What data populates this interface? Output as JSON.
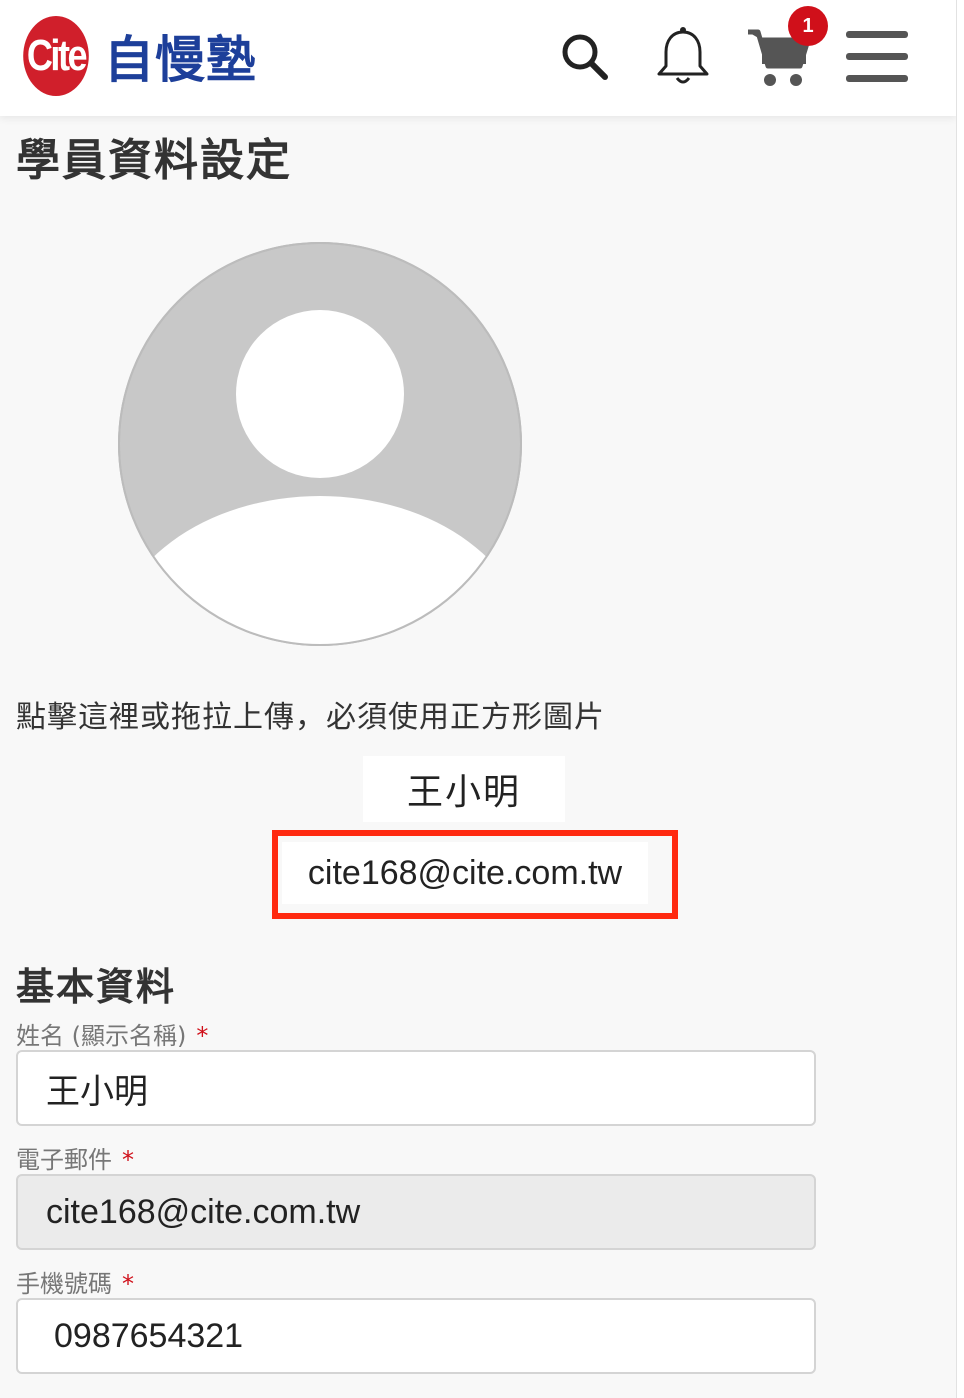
{
  "header": {
    "logo_mark": "Cite",
    "logo_text": "自慢塾",
    "cart_count": "1",
    "icons": [
      "search-icon",
      "bell-icon",
      "cart-icon",
      "menu-icon"
    ]
  },
  "page": {
    "title": "學員資料設定"
  },
  "profile": {
    "upload_hint": "點擊這裡或拖拉上傳，必須使用正方形圖片",
    "display_name": "王小明",
    "email": "cite168@cite.com.tw"
  },
  "basic_info": {
    "section_title": "基本資料",
    "name_label": "姓名 (顯示名稱)",
    "name_value": "王小明",
    "email_label": "電子郵件",
    "email_value": "cite168@cite.com.tw",
    "phone_label": "手機號碼",
    "phone_value": "0987654321",
    "required_mark": "*"
  },
  "colors": {
    "brand_red": "#d01f2b",
    "brand_blue": "#1d3f9a",
    "highlight": "#ff2a10"
  }
}
